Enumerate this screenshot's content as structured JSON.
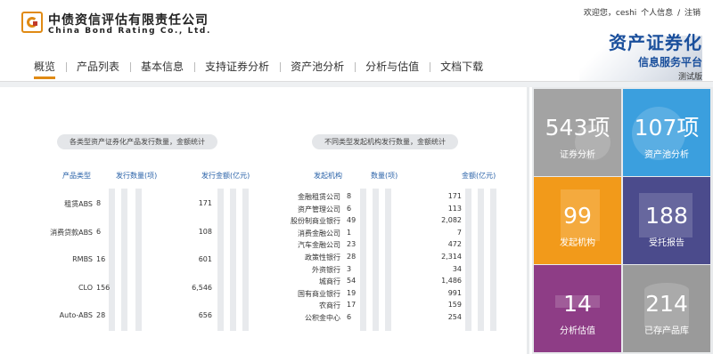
{
  "header": {
    "company_cn": "中债资信评估有限责任公司",
    "company_en": "China Bond Rating Co., Ltd.",
    "welcome": "欢迎您，ceshi",
    "profile_link": "个人信息",
    "separator": "/",
    "logout_link": "注销",
    "brand_title": "资产证券化",
    "brand_subtitle": "信息服务平台",
    "brand_version": "测试版"
  },
  "nav": {
    "items": [
      "概览",
      "产品列表",
      "基本信息",
      "支持证券分析",
      "资产池分析",
      "分析与估值",
      "文档下载"
    ],
    "active_index": 0
  },
  "left_chart": {
    "title": "各类型资产证券化产品发行数量，金额统计",
    "headers": {
      "type": "产品类型",
      "count": "发行数量(项)",
      "amount": "发行金额(亿元)"
    },
    "rows": [
      {
        "name": "租赁ABS",
        "count": "8",
        "amount": "171"
      },
      {
        "name": "消费贷款ABS",
        "count": "6",
        "amount": "108"
      },
      {
        "name": "RMBS",
        "count": "16",
        "amount": "601"
      },
      {
        "name": "CLO",
        "count": "156",
        "amount": "6,546"
      },
      {
        "name": "Auto-ABS",
        "count": "28",
        "amount": "656"
      }
    ]
  },
  "right_chart": {
    "title": "不同类型发起机构发行数量，金额统计",
    "headers": {
      "issuer": "发起机构",
      "count": "数量(项)",
      "amount": "金额(亿元)"
    },
    "rows": [
      {
        "name": "金融租赁公司",
        "count": "8",
        "amount": "171"
      },
      {
        "name": "资产管理公司",
        "count": "6",
        "amount": "113"
      },
      {
        "name": "股份制商业银行",
        "count": "49",
        "amount": "2,082"
      },
      {
        "name": "消费金融公司",
        "count": "1",
        "amount": "7"
      },
      {
        "name": "汽车金融公司",
        "count": "23",
        "amount": "472"
      },
      {
        "name": "政策性银行",
        "count": "28",
        "amount": "2,314"
      },
      {
        "name": "外资银行",
        "count": "3",
        "amount": "34"
      },
      {
        "name": "城商行",
        "count": "54",
        "amount": "1,486"
      },
      {
        "name": "国有商业银行",
        "count": "19",
        "amount": "991"
      },
      {
        "name": "农商行",
        "count": "17",
        "amount": "159"
      },
      {
        "name": "公积金中心",
        "count": "6",
        "amount": "254"
      }
    ]
  },
  "tiles": [
    {
      "number": "543项",
      "label": "证券分析",
      "color": "#a3a3a3",
      "icon": "chart-icon"
    },
    {
      "number": "107项",
      "label": "资产池分析",
      "color": "#3b9fde",
      "icon": "pie-icon"
    },
    {
      "number": "99",
      "label": "发起机构",
      "color": "#f29a1a",
      "icon": "document-icon"
    },
    {
      "number": "188",
      "label": "受托报告",
      "color": "#4b4b8c",
      "icon": "table-icon"
    },
    {
      "number": "14",
      "label": "分析估值",
      "color": "#8e3d86",
      "icon": "plus-icon"
    },
    {
      "number": "214",
      "label": "已存产品库",
      "color": "#9a9a9a",
      "icon": "database-icon"
    }
  ]
}
